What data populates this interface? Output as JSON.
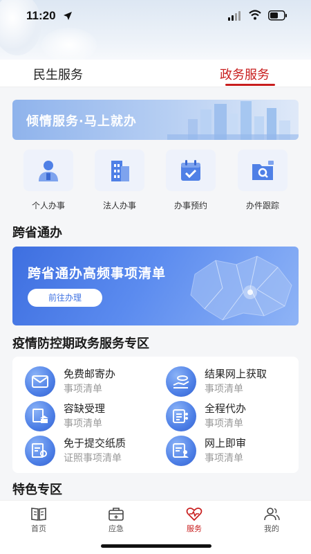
{
  "status": {
    "time": "11:20"
  },
  "tabs": [
    {
      "label": "民生服务",
      "active": false
    },
    {
      "label": "政务服务",
      "active": true
    }
  ],
  "banner_top": {
    "text": "倾情服务·马上就办"
  },
  "quick": [
    {
      "label": "个人办事",
      "icon": "person-icon"
    },
    {
      "label": "法人办事",
      "icon": "building-icon"
    },
    {
      "label": "办事预约",
      "icon": "calendar-check-icon"
    },
    {
      "label": "办件跟踪",
      "icon": "folder-search-icon"
    }
  ],
  "section_cross": {
    "title": "跨省通办"
  },
  "banner_cross": {
    "title": "跨省通办高频事项清单",
    "button": "前往办理"
  },
  "section_epidemic": {
    "title": "疫情防控期政务服务专区"
  },
  "services": [
    {
      "title": "免费邮寄办",
      "subtitle": "事项清单",
      "icon": "mail-icon"
    },
    {
      "title": "结果网上获取",
      "subtitle": "事项清单",
      "icon": "hand-coin-icon"
    },
    {
      "title": "容缺受理",
      "subtitle": "事项清单",
      "icon": "document-bank-icon"
    },
    {
      "title": "全程代办",
      "subtitle": "事项清单",
      "icon": "list-card-icon"
    },
    {
      "title": "免于提交纸质",
      "subtitle": "证照事项清单",
      "icon": "paper-search-icon"
    },
    {
      "title": "网上即审",
      "subtitle": "事项清单",
      "icon": "review-user-icon"
    }
  ],
  "section_special": {
    "title": "特色专区"
  },
  "bottom_nav": [
    {
      "label": "首页",
      "icon": "book-icon",
      "active": false
    },
    {
      "label": "应急",
      "icon": "kit-icon",
      "active": false
    },
    {
      "label": "服务",
      "icon": "heart-pulse-icon",
      "active": true
    },
    {
      "label": "我的",
      "icon": "users-icon",
      "active": false
    }
  ],
  "colors": {
    "accent": "#c81d1d",
    "primary_blue": "#4d7fe6"
  }
}
